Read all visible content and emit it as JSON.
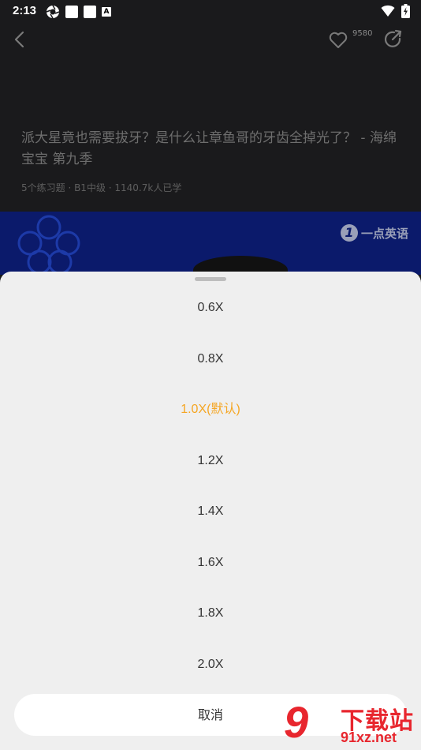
{
  "status_bar": {
    "time": "2:13",
    "left_icons": [
      "aperture-icon",
      "notification-square-icon",
      "notification-square-icon",
      "a-icon"
    ],
    "right_icons": [
      "wifi-icon",
      "battery-charging-icon"
    ]
  },
  "header": {
    "back_icon": "chevron-left-icon",
    "like_icon": "heart-icon",
    "like_count": "9580",
    "share_icon": "share-icon"
  },
  "video": {
    "title": "派大星竟也需要拔牙？是什么让章鱼哥的牙齿全掉光了？ - 海绵宝宝 第九季",
    "meta": "5个练习题 · B1中级 · 1140.7k人已学",
    "watermark": "一点英语",
    "watermark_mark": "1",
    "background_color": "#0b1a6b"
  },
  "speed_sheet": {
    "options": [
      "0.6X",
      "0.8X",
      "1.0X(默认)",
      "1.2X",
      "1.4X",
      "1.6X",
      "1.8X",
      "2.0X"
    ],
    "selected": "1.0X(默认)",
    "selected_color": "#f5a623",
    "cancel_label": "取消"
  },
  "corner_watermark": {
    "big": "9",
    "text1": "下载站",
    "text2": "91xz.net",
    "color": "#e8262e"
  }
}
